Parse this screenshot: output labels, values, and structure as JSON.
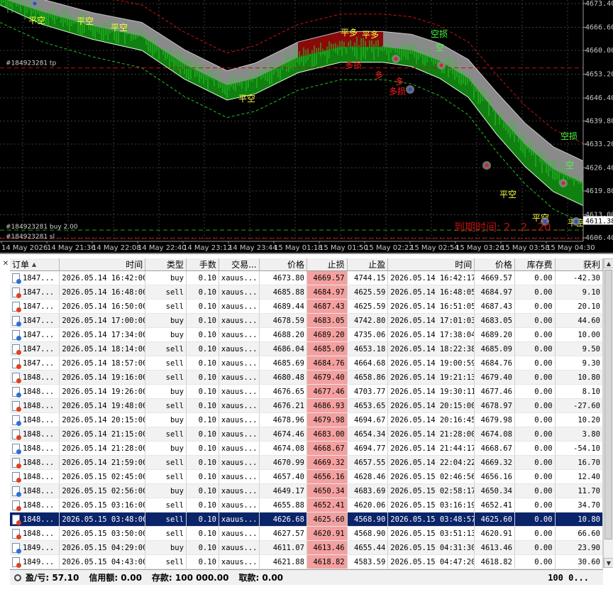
{
  "chart": {
    "price_labels": [
      "4673.40",
      "4666.60",
      "4660.00",
      "4653.20",
      "4646.40",
      "4639.80",
      "4633.20",
      "4626.40",
      "4619.80",
      "4613.00",
      "4606.40"
    ],
    "current_price": "4611.38",
    "time_labels": [
      "14 May 2026",
      "14 May 21:36",
      "14 May 22:08",
      "14 May 22:40",
      "14 May 23:12",
      "14 May 23:44",
      "15 May 01:18",
      "15 May 01:50",
      "15 May 02:22",
      "15 May 02:54",
      "15 May 03:26",
      "15 May 03:58",
      "15 May 04:30"
    ],
    "line_labels": {
      "tp": "#184923281 tp",
      "buy": "#184923281 buy 2.00",
      "sl": "#184923281 sl"
    },
    "expiry_text": "到期时间: 2...2...20 ...",
    "signals": [
      {
        "text": "平空",
        "color": "yellow"
      },
      {
        "text": "平空",
        "color": "yellow"
      },
      {
        "text": "平空",
        "color": "yellow"
      },
      {
        "text": "平空",
        "color": "yellow"
      },
      {
        "text": "平多",
        "color": "yellow"
      },
      {
        "text": "平多",
        "color": "yellow"
      },
      {
        "text": "多损",
        "color": "red"
      },
      {
        "text": "多损",
        "color": "red"
      },
      {
        "text": "多",
        "color": "red"
      },
      {
        "text": "多",
        "color": "red"
      },
      {
        "text": "空损",
        "color": "green"
      },
      {
        "text": "空",
        "color": "green"
      },
      {
        "text": "空损",
        "color": "green"
      },
      {
        "text": "空",
        "color": "green"
      },
      {
        "text": "平空",
        "color": "yellow"
      },
      {
        "text": "平空",
        "color": "yellow"
      },
      {
        "text": "平空",
        "color": "yellow"
      }
    ]
  },
  "table": {
    "headers": [
      "订单",
      "时间",
      "类型",
      "手数",
      "交易...",
      "价格",
      "止损",
      "止盈",
      "时间",
      "价格",
      "库存费",
      "获利"
    ],
    "rows": [
      [
        "1847...",
        "2026.05.14 16:42:00",
        "buy",
        "0.10",
        "xauus...",
        "4673.80",
        "4669.57",
        "4744.15",
        "2026.05.14 16:42:17",
        "4669.57",
        "0.00",
        "-42.30"
      ],
      [
        "1847...",
        "2026.05.14 16:48:00",
        "sell",
        "0.10",
        "xauus...",
        "4685.88",
        "4684.97",
        "4625.59",
        "2026.05.14 16:48:05",
        "4684.97",
        "0.00",
        "9.10"
      ],
      [
        "1847...",
        "2026.05.14 16:50:00",
        "sell",
        "0.10",
        "xauus...",
        "4689.44",
        "4687.43",
        "4625.59",
        "2026.05.14 16:51:05",
        "4687.43",
        "0.00",
        "20.10"
      ],
      [
        "1847...",
        "2026.05.14 17:00:00",
        "buy",
        "0.10",
        "xauus...",
        "4678.59",
        "4683.05",
        "4742.80",
        "2026.05.14 17:01:03",
        "4683.05",
        "0.00",
        "44.60"
      ],
      [
        "1847...",
        "2026.05.14 17:34:00",
        "buy",
        "0.10",
        "xauus...",
        "4688.20",
        "4689.20",
        "4735.06",
        "2026.05.14 17:38:04",
        "4689.20",
        "0.00",
        "10.00"
      ],
      [
        "1847...",
        "2026.05.14 18:14:00",
        "sell",
        "0.10",
        "xauus...",
        "4686.04",
        "4685.09",
        "4653.18",
        "2026.05.14 18:22:38",
        "4685.09",
        "0.00",
        "9.50"
      ],
      [
        "1847...",
        "2026.05.14 18:57:00",
        "sell",
        "0.10",
        "xauus...",
        "4685.69",
        "4684.76",
        "4664.68",
        "2026.05.14 19:00:59",
        "4684.76",
        "0.00",
        "9.30"
      ],
      [
        "1848...",
        "2026.05.14 19:16:00",
        "sell",
        "0.10",
        "xauus...",
        "4680.48",
        "4679.40",
        "4658.86",
        "2026.05.14 19:21:13",
        "4679.40",
        "0.00",
        "10.80"
      ],
      [
        "1848...",
        "2026.05.14 19:26:00",
        "buy",
        "0.10",
        "xauus...",
        "4676.65",
        "4677.46",
        "4703.77",
        "2026.05.14 19:30:11",
        "4677.46",
        "0.00",
        "8.10"
      ],
      [
        "1848...",
        "2026.05.14 19:48:00",
        "sell",
        "0.10",
        "xauus...",
        "4676.21",
        "4686.93",
        "4653.65",
        "2026.05.14 20:15:00",
        "4678.97",
        "0.00",
        "-27.60"
      ],
      [
        "1848...",
        "2026.05.14 20:15:00",
        "buy",
        "0.10",
        "xauus...",
        "4678.96",
        "4679.98",
        "4694.67",
        "2026.05.14 20:16:45",
        "4679.98",
        "0.00",
        "10.20"
      ],
      [
        "1848...",
        "2026.05.14 21:15:00",
        "sell",
        "0.10",
        "xauus...",
        "4674.46",
        "4683.00",
        "4654.34",
        "2026.05.14 21:28:00",
        "4674.08",
        "0.00",
        "3.80"
      ],
      [
        "1848...",
        "2026.05.14 21:28:00",
        "buy",
        "0.10",
        "xauus...",
        "4674.08",
        "4668.67",
        "4694.77",
        "2026.05.14 21:44:17",
        "4668.67",
        "0.00",
        "-54.10"
      ],
      [
        "1848...",
        "2026.05.14 21:59:00",
        "sell",
        "0.10",
        "xauus...",
        "4670.99",
        "4669.32",
        "4657.55",
        "2026.05.14 22:04:22",
        "4669.32",
        "0.00",
        "16.70"
      ],
      [
        "1848...",
        "2026.05.15 02:45:00",
        "sell",
        "0.10",
        "xauus...",
        "4657.40",
        "4656.16",
        "4628.46",
        "2026.05.15 02:46:56",
        "4656.16",
        "0.00",
        "12.40"
      ],
      [
        "1848...",
        "2026.05.15 02:56:00",
        "buy",
        "0.10",
        "xauus...",
        "4649.17",
        "4650.34",
        "4683.69",
        "2026.05.15 02:58:17",
        "4650.34",
        "0.00",
        "11.70"
      ],
      [
        "1848...",
        "2026.05.15 03:16:00",
        "sell",
        "0.10",
        "xauus...",
        "4655.88",
        "4652.41",
        "4620.06",
        "2026.05.15 03:16:19",
        "4652.41",
        "0.00",
        "34.70"
      ],
      [
        "1848...",
        "2026.05.15 03:48:00",
        "sell",
        "0.10",
        "xauus...",
        "4626.68",
        "4625.60",
        "4568.90",
        "2026.05.15 03:48:57",
        "4625.60",
        "0.00",
        "10.80"
      ],
      [
        "1848...",
        "2026.05.15 03:50:00",
        "sell",
        "0.10",
        "xauus...",
        "4627.57",
        "4620.91",
        "4568.90",
        "2026.05.15 03:51:13",
        "4620.91",
        "0.00",
        "66.60"
      ],
      [
        "1849...",
        "2026.05.15 04:29:00",
        "buy",
        "0.10",
        "xauus...",
        "4611.07",
        "4613.46",
        "4655.44",
        "2026.05.15 04:31:30",
        "4613.46",
        "0.00",
        "23.90"
      ],
      [
        "1849...",
        "2026.05.15 04:43:00",
        "sell",
        "0.10",
        "xauus...",
        "4621.88",
        "4618.82",
        "4583.59",
        "2026.05.15 04:47:20",
        "4618.82",
        "0.00",
        "30.60"
      ]
    ],
    "selected_row": 17
  },
  "summary": {
    "profit": "盈/亏: 57.10",
    "credit": "信用额: 0.00",
    "deposit": "存款: 100 000.00",
    "withdraw": "取款: 0.00",
    "total": "100 0..."
  },
  "colors": {
    "band_green": "#108010",
    "band_grey": "#8a8a8a",
    "band_red": "#8a0a0a",
    "candle": "#28c828",
    "sl_cell": "#f4a0a0",
    "selected_row": "#0a246a"
  }
}
